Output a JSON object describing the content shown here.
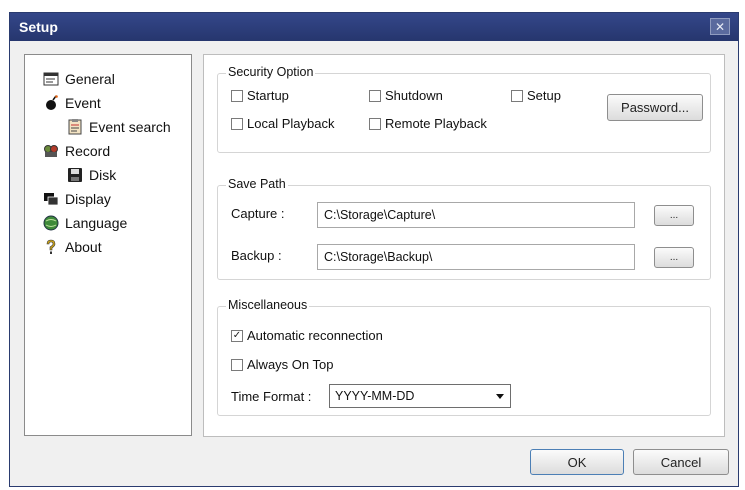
{
  "window": {
    "title": "Setup",
    "close_glyph": "✕"
  },
  "nav": {
    "items": [
      {
        "label": "General",
        "icon": "general-icon"
      },
      {
        "label": "Event",
        "icon": "event-icon"
      },
      {
        "label": "Event search",
        "icon": "event-search-icon"
      },
      {
        "label": "Record",
        "icon": "record-icon"
      },
      {
        "label": "Disk",
        "icon": "disk-icon"
      },
      {
        "label": "Display",
        "icon": "display-icon"
      },
      {
        "label": "Language",
        "icon": "language-icon"
      },
      {
        "label": "About",
        "icon": "about-icon"
      }
    ]
  },
  "security": {
    "title": "Security Option",
    "startup": {
      "label": "Startup",
      "checked": false
    },
    "shutdown": {
      "label": "Shutdown",
      "checked": false
    },
    "setup": {
      "label": "Setup",
      "checked": false
    },
    "local_playback": {
      "label": "Local Playback",
      "checked": false
    },
    "remote_playback": {
      "label": "Remote Playback",
      "checked": false
    },
    "password_button": "Password..."
  },
  "save_path": {
    "title": "Save Path",
    "capture_label": "Capture :",
    "capture_value": "C:\\Storage\\Capture\\",
    "backup_label": "Backup :",
    "backup_value": "C:\\Storage\\Backup\\",
    "browse_label": "..."
  },
  "misc": {
    "title": "Miscellaneous",
    "auto_reconnect": {
      "label": "Automatic reconnection",
      "checked": true
    },
    "always_on_top": {
      "label": "Always On Top",
      "checked": false
    },
    "time_format_label": "Time Format :",
    "time_format_value": "YYYY-MM-DD"
  },
  "footer": {
    "ok": "OK",
    "cancel": "Cancel"
  }
}
